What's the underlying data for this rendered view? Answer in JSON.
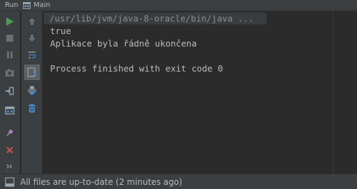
{
  "titlebar": {
    "run_label": "Run",
    "tab_label": "Main"
  },
  "console": {
    "command": "/usr/lib/jvm/java-8-oracle/bin/java ...",
    "lines": [
      "true",
      "Aplikace byla řádně ukončena",
      "",
      "Process finished with exit code 0"
    ]
  },
  "toolbar_left": [
    "rerun-icon",
    "stop-icon",
    "pause-icon",
    "camera-icon",
    "exit-icon",
    "layout-icon",
    "pin-icon",
    "close-icon",
    "more-icon"
  ],
  "toolbar_right": [
    "up-arrow-icon",
    "down-arrow-icon",
    "soft-wrap-icon",
    "scroll-to-end-icon",
    "print-icon",
    "trash-icon"
  ],
  "statusbar": {
    "text": "All files are up-to-date (2 minutes ago)"
  },
  "colors": {
    "run_green": "#499c54",
    "close_red": "#c75450",
    "accent_blue": "#4a88c7",
    "background": "#2b2b2b",
    "panel": "#3c3f41",
    "text": "#bbbbbb"
  }
}
